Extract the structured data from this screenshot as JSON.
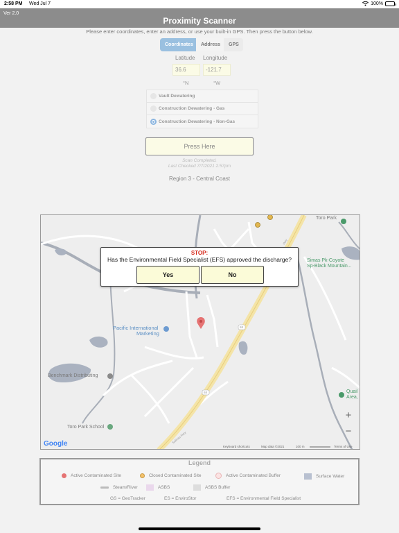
{
  "status_bar": {
    "time": "2:58 PM",
    "date": "Wed Jul 7",
    "battery": "100%"
  },
  "header": {
    "version": "Ver 2.0",
    "title": "Proximity Scanner"
  },
  "instructions": "Please enter coordinates, enter an address, or use your built-in GPS. Then press the button below.",
  "tabs": [
    {
      "label": "Coordinates",
      "selected": true
    },
    {
      "label": "Address",
      "selected": false
    },
    {
      "label": "GPS",
      "selected": false
    }
  ],
  "coordinates": {
    "latitude_label": "Latitude",
    "longitude_label": "Longitude",
    "latitude_value": "36.6",
    "longitude_value": "-121.7",
    "latitude_unit": "°N",
    "longitude_unit": "°W"
  },
  "options": [
    {
      "label": "Vault Dewatering",
      "selected": false
    },
    {
      "label": "Construction Dewatering - Gas",
      "selected": false
    },
    {
      "label": "Construction Dewatering - Non-Gas",
      "selected": true
    }
  ],
  "press_button": "Press Here",
  "scan": {
    "status": "Scan Completed.",
    "last_checked": "Last Checked 7/7/2021 2:57pm"
  },
  "region": "Region 3 - Central Coast",
  "map": {
    "labels": {
      "toro_park": "Toro Park",
      "simas": "Simas Pk-Coyote",
      "simas2": "Sp-Black Mountain...",
      "pacific": "Pacific International",
      "pacific2": "Marketing",
      "benchmark": "Benchmark Distributing",
      "toro_school": "Toro Park School",
      "quail": "Quail",
      "quail2": "Area,",
      "salinas": "Salinas Hwy",
      "hwy_hwy": "Hwy",
      "route_68a": "68",
      "route_68b": "68"
    },
    "zoom_in": "+",
    "zoom_out": "−",
    "attribution": {
      "shortcuts": "Keyboard shortcuts",
      "data": "Map data ©2021",
      "scale": "100 m",
      "terms": "Terms of Use"
    },
    "google": "Google"
  },
  "dialog": {
    "stop": "STOP:",
    "question": "Has the Environmental Field Specialist (EFS) approved the discharge?",
    "yes": "Yes",
    "no": "No"
  },
  "legend": {
    "title": "Legend",
    "items": [
      {
        "label": "Active Contaminated Site",
        "color": "#e57373"
      },
      {
        "label": "Closed Contaminated Site",
        "color": "#f5c26b"
      },
      {
        "label": "Active Contaminated Buffer",
        "color": "#fbe3e3"
      },
      {
        "label": "Surface Water",
        "color": "#b8c0d0"
      },
      {
        "label": "Steam/River",
        "color": "#bbbbbb"
      },
      {
        "label": "ASBS",
        "color": "#ead8ec"
      },
      {
        "label": "ASBS Buffer",
        "color": "#dddddd"
      }
    ],
    "abbreviations": [
      "GS = GeoTracker",
      "ES = EnviroStor",
      "EFS = Environmental Field Specialist"
    ]
  }
}
